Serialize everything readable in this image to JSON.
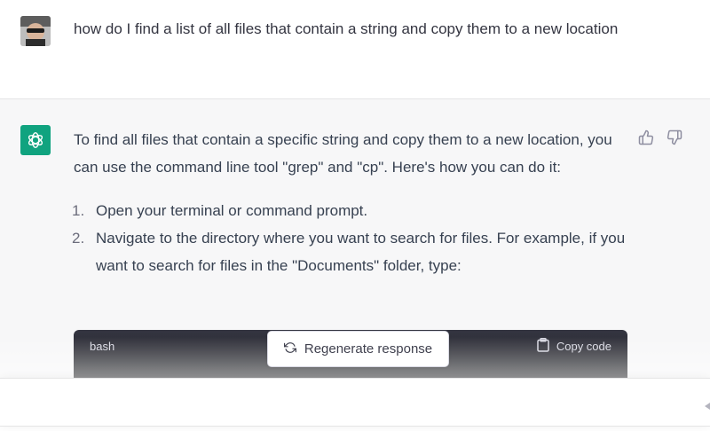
{
  "user_message": {
    "text": "how do I find a list of all files that contain a string and copy them to a new location"
  },
  "assistant_message": {
    "intro": "To find all files that contain a specific string and copy them to a new location, you can use the command line tool \"grep\" and \"cp\". Here's how you can do it:",
    "steps": [
      {
        "number": "1.",
        "text": "Open your terminal or command prompt."
      },
      {
        "number": "2.",
        "text": "Navigate to the directory where you want to search for files. For example, if you want to search for files in the \"Documents\" folder, type:"
      }
    ],
    "code_block": {
      "language": "bash",
      "copy_label": "Copy code"
    }
  },
  "regenerate": {
    "label": "Regenerate response"
  },
  "composer": {
    "value": "",
    "placeholder": ""
  },
  "colors": {
    "accent": "#10a37f",
    "assistant_bg": "#f7f7f8",
    "code_header_bg": "#343541"
  },
  "icons": {
    "user_avatar": "user-avatar-photo",
    "assistant_avatar": "openai-logo-icon",
    "thumbs_up": "thumbs-up-icon",
    "thumbs_down": "thumbs-down-icon",
    "clipboard": "clipboard-icon",
    "refresh": "refresh-icon",
    "send": "send-icon"
  }
}
